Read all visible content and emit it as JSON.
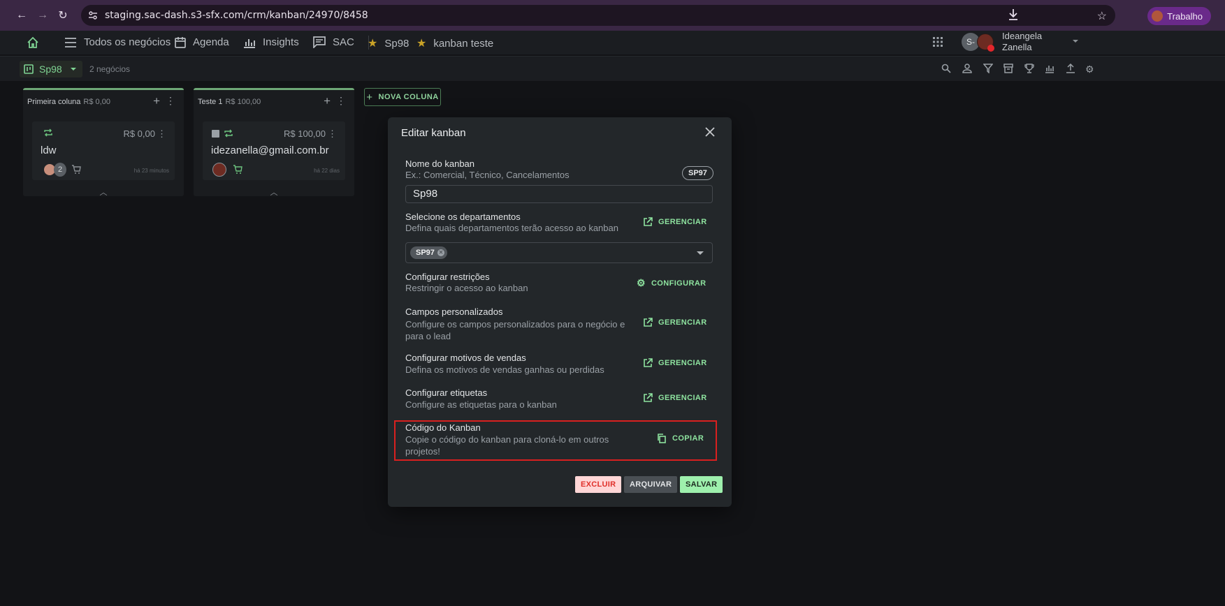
{
  "browser": {
    "url": "staging.sac-dash.s3-sfx.com/crm/kanban/24970/8458",
    "profile_label": "Trabalho"
  },
  "header": {
    "nav": [
      {
        "label": "Todos os negócios",
        "icon": "menu-icon"
      },
      {
        "label": "Agenda",
        "icon": "calendar-icon"
      },
      {
        "label": "Insights",
        "icon": "bar-chart-icon"
      },
      {
        "label": "SAC",
        "icon": "chat-icon"
      }
    ],
    "favorites": [
      {
        "label": "Sp98",
        "icon": "star-icon"
      },
      {
        "label": "kanban teste",
        "icon": "star-icon"
      }
    ],
    "user": {
      "name_line1": "Ideangela",
      "name_line2": "Zanella",
      "avatar_initials": "S-"
    }
  },
  "toolbar": {
    "kanban_name": "Sp98",
    "deals_count": "2 negócios"
  },
  "columns": [
    {
      "title": "Primeira coluna",
      "value": "R$ 0,00",
      "card": {
        "amount": "R$ 0,00",
        "title": "ldw",
        "time": "há 23 minutos",
        "avatar_count": "2"
      }
    },
    {
      "title": "Teste 1",
      "value": "R$ 100,00",
      "card": {
        "amount": "R$ 100,00",
        "title": "idezanella@gmail.com.br",
        "time": "há 22 dias"
      }
    }
  ],
  "new_column_label": "NOVA COLUNA",
  "modal": {
    "title": "Editar kanban",
    "name": {
      "title": "Nome do kanban",
      "subtitle": "Ex.: Comercial, Técnico, Cancelamentos",
      "badge": "SP97",
      "value": "Sp98"
    },
    "departments": {
      "title": "Selecione os departamentos",
      "subtitle": "Defina quais departamentos terão acesso ao kanban",
      "action": "GERENCIAR",
      "chip": "SP97"
    },
    "restrictions": {
      "title": "Configurar restrições",
      "subtitle": "Restringir o acesso ao kanban",
      "action": "CONFIGURAR"
    },
    "custom_fields": {
      "title": "Campos personalizados",
      "subtitle_line1": "Configure os campos personalizados para o negócio e",
      "subtitle_line2": "para o lead",
      "action": "GERENCIAR"
    },
    "sales_reasons": {
      "title": "Configurar motivos de vendas",
      "subtitle": "Defina os motivos de vendas ganhas ou perdidas",
      "action": "GERENCIAR"
    },
    "tags": {
      "title": "Configurar etiquetas",
      "subtitle": "Configure as etiquetas para o kanban",
      "action": "GERENCIAR"
    },
    "code": {
      "title": "Código do Kanban",
      "subtitle_line1": "Copie o código do kanban para cloná-lo em outros",
      "subtitle_line2": "projetos!",
      "action": "COPIAR"
    },
    "buttons": {
      "delete": "EXCLUIR",
      "archive": "ARQUIVAR",
      "save": "SALVAR"
    }
  },
  "colors": {
    "accent_green": "#8ee39f",
    "highlight_red": "#d9201f",
    "delete_bg": "#ffd6d6",
    "delete_text": "#e0302a",
    "save_bg": "#9ef0ad"
  }
}
